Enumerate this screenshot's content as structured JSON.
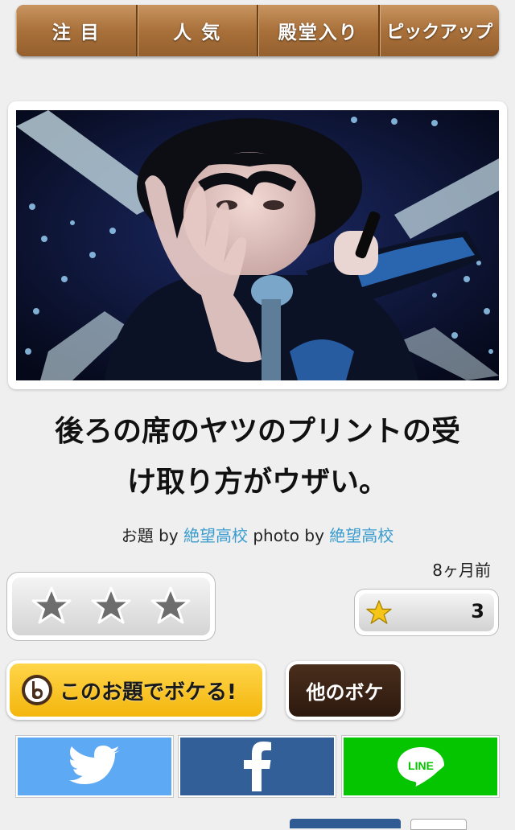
{
  "tabs": [
    {
      "label": "注 目"
    },
    {
      "label": "人 気"
    },
    {
      "label": "殿堂入り"
    },
    {
      "label": "ピックアップ"
    }
  ],
  "caption": {
    "line1": "後ろの席のヤツのプリントの受",
    "line2": "け取り方がウザい。"
  },
  "credits": {
    "odai_label": "お題 by ",
    "odai_user": "絶望高校",
    "photo_label": " photo by ",
    "photo_user": "絶望高校"
  },
  "posted_time": "8ヶ月前",
  "rating": {
    "stars": 3,
    "score": "3"
  },
  "buttons": {
    "boke": "このお題でボケる!",
    "other": "他のボケ"
  },
  "share": {
    "line_text": "LINE"
  },
  "colors": {
    "twitter": "#5ea9f3",
    "facebook": "#335f99",
    "line": "#05c400",
    "link": "#3a9ccf",
    "tab_brown": "#a9703a"
  }
}
